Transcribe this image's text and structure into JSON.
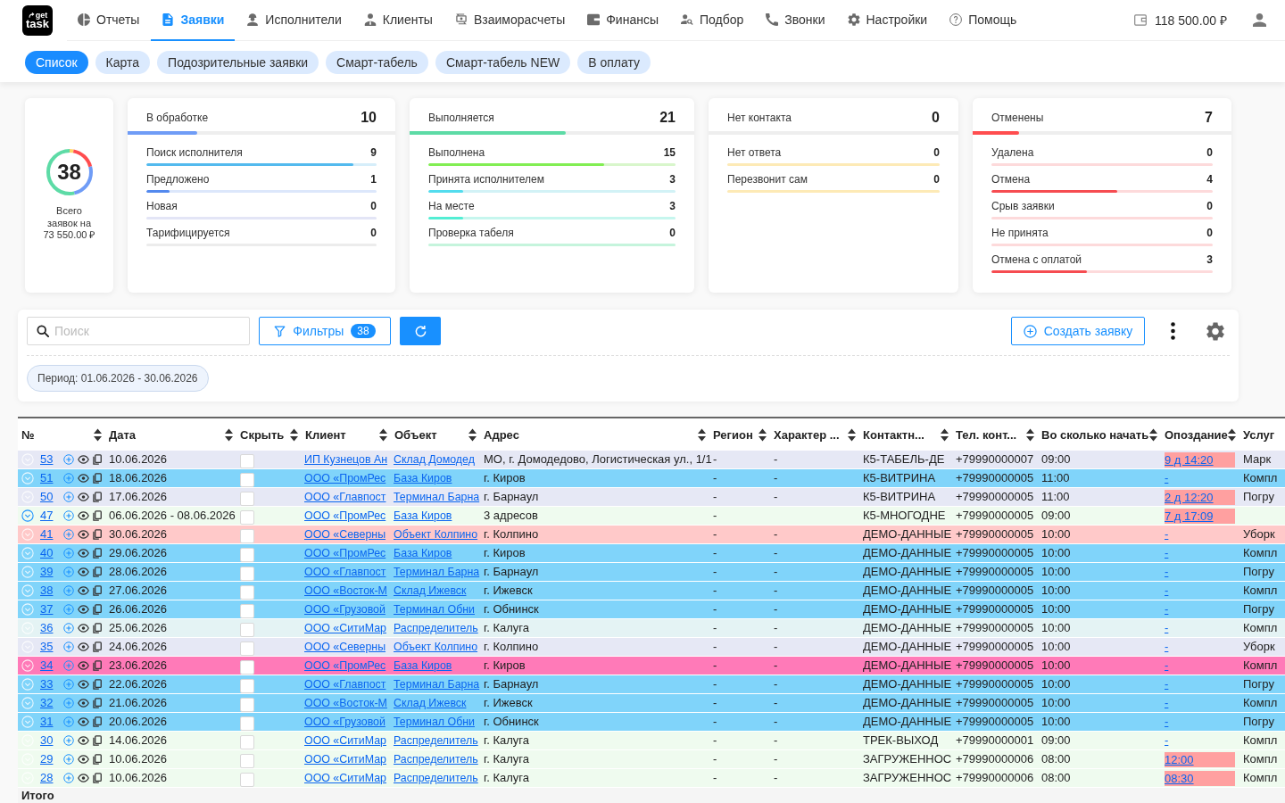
{
  "logo": {
    "line_1": "get",
    "line_2": "task"
  },
  "nav": [
    {
      "label": "Отчеты",
      "selected": false
    },
    {
      "label": "Заявки",
      "selected": true
    },
    {
      "label": "Исполнители",
      "selected": false
    },
    {
      "label": "Клиенты",
      "selected": false
    },
    {
      "label": "Взаиморасчеты",
      "selected": false
    },
    {
      "label": "Финансы",
      "selected": false
    },
    {
      "label": "Подбор",
      "selected": false
    },
    {
      "label": "Звонки",
      "selected": false
    },
    {
      "label": "Настройки",
      "selected": false
    },
    {
      "label": "Помощь",
      "selected": false
    }
  ],
  "balance": "118 500.00 ₽",
  "subtabs": [
    {
      "label": "Список",
      "selected": true
    },
    {
      "label": "Карта",
      "selected": false
    },
    {
      "label": "Подозрительные заявки",
      "selected": false
    },
    {
      "label": "Смарт-табель",
      "selected": false
    },
    {
      "label": "Смарт-табель NEW",
      "selected": false
    },
    {
      "label": "В оплату",
      "selected": false
    }
  ],
  "summary": {
    "total": "38",
    "caption": "Всего заявок на 73 550.00 ₽"
  },
  "groups": [
    {
      "title": "В обработке",
      "count": "10",
      "level": 0.26,
      "color": "#6f9cf6",
      "items": [
        {
          "label": "Поиск исполнителя",
          "count": "9",
          "level": 0.9,
          "color": "#d6eefa"
        },
        {
          "label": "Предложено",
          "count": "1",
          "level": 0.1,
          "color": "#dce7fb"
        },
        {
          "label": "Новая",
          "count": "0",
          "level": 0,
          "color": "#e3e5f6"
        },
        {
          "label": "Тарифицируется",
          "count": "0",
          "level": 0,
          "color": "#ececec"
        }
      ]
    },
    {
      "title": "Выполняется",
      "count": "21",
      "level": 0.55,
      "color": "#5ddba6",
      "items": [
        {
          "label": "Выполнена",
          "count": "15",
          "level": 0.71,
          "color": "#d8f6cb"
        },
        {
          "label": "Принята исполнителем",
          "count": "3",
          "level": 0.14,
          "color": "#d2f2f6"
        },
        {
          "label": "На месте",
          "count": "3",
          "level": 0.14,
          "color": "#c6f6ee"
        },
        {
          "label": "Проверка табеля",
          "count": "0",
          "level": 0,
          "color": "#c5f4dc"
        }
      ]
    },
    {
      "title": "Нет контакта",
      "count": "0",
      "level": 0,
      "color": "#ffd666",
      "items": [
        {
          "label": "Нет ответа",
          "count": "0",
          "level": 0,
          "color": "#fdeab6"
        },
        {
          "label": "Перезвонит сам",
          "count": "0",
          "level": 0,
          "color": "#fdeab6"
        }
      ]
    },
    {
      "title": "Отменены",
      "count": "7",
      "level": 0.18,
      "color": "#ff4d4f",
      "items": [
        {
          "label": "Удалена",
          "count": "0",
          "level": 0,
          "color": "#fddadb"
        },
        {
          "label": "Отмена",
          "count": "4",
          "level": 0.57,
          "color": "#fddadb"
        },
        {
          "label": "Срыв заявки",
          "count": "0",
          "level": 0,
          "color": "#fddadb"
        },
        {
          "label": "Не принята",
          "count": "0",
          "level": 0,
          "color": "#fddadb"
        },
        {
          "label": "Отмена с оплатой",
          "count": "3",
          "level": 0.43,
          "color": "#fddadb"
        }
      ]
    }
  ],
  "toolbar": {
    "search": {
      "placeholder": "Поиск"
    },
    "filters": {
      "label": "Фильтры",
      "count": "38"
    },
    "create": {
      "label": "Создать заявку"
    },
    "period": "Период: 01.06.2026 - 30.06.2026"
  },
  "table": {
    "columns": [
      {
        "label": "№",
        "sortable": true
      },
      {
        "label": "Дата",
        "sortable": true
      },
      {
        "label": "Скрыть",
        "sortable": true
      },
      {
        "label": "Клиент",
        "sortable": true
      },
      {
        "label": "Объект",
        "sortable": true
      },
      {
        "label": "Адрес",
        "sortable": true
      },
      {
        "label": "Регион",
        "sortable": true
      },
      {
        "label": "Характер ...",
        "sortable": true
      },
      {
        "label": "Контактн...",
        "sortable": true
      },
      {
        "label": "Тел. конт...",
        "sortable": true
      },
      {
        "label": "Во сколько начать",
        "sortable": true
      },
      {
        "label": "Опоздание",
        "sortable": true
      },
      {
        "label": "Услуг",
        "sortable": false
      }
    ],
    "rows": [
      {
        "number": "53",
        "expandable": false,
        "date": "10.06.2026",
        "checked": false,
        "client": "ИП Кузнецов Ан",
        "object": "Склад Домодед",
        "address": "МО, г. Домодедово, Логистическая ул., 1/1",
        "region": "-",
        "character": "-",
        "contact": "К5-ТАБЕЛЬ-ДЕ",
        "phone": "+79990000007",
        "start": "09:00",
        "delay": "9 д 14:20",
        "late": true,
        "service": "Марк",
        "color": "#e6e8f5"
      },
      {
        "number": "51",
        "expandable": false,
        "date": "18.06.2026",
        "checked": false,
        "client": "ООО «ПромРес",
        "object": "База Киров",
        "address": "г. Киров",
        "region": "-",
        "character": "-",
        "contact": "К5-ВИТРИНА",
        "phone": "+79990000005",
        "start": "11:00",
        "delay": "-",
        "late": false,
        "service": "Компл",
        "color": "#80d4fa"
      },
      {
        "number": "50",
        "expandable": false,
        "date": "17.06.2026",
        "checked": false,
        "client": "ООО «Главпост",
        "object": "Терминал Барна",
        "address": "г. Барнаул",
        "region": "-",
        "character": "-",
        "contact": "К5-ВИТРИНА",
        "phone": "+79990000005",
        "start": "11:00",
        "delay": "2 д 12:20",
        "late": true,
        "service": "Погру",
        "color": "#e6e8f5"
      },
      {
        "number": "47",
        "expandable": true,
        "date": "06.06.2026 - 08.06.2026",
        "checked": false,
        "client": "ООО «ПромРес",
        "object": "База Киров",
        "address": "3 адресов",
        "region": "-",
        "contact": "К5-МНОГОДНЕ",
        "phone": "+79990000005",
        "start": "09:00",
        "delay": "7 д 17:09",
        "late": true,
        "color": "#effbef"
      },
      {
        "number": "41",
        "expandable": false,
        "date": "30.06.2026",
        "checked": false,
        "client": "ООО «Северны",
        "object": "Объект Колпино",
        "address": "г. Колпино",
        "region": "-",
        "character": "-",
        "contact": "ДЕМО-ДАННЫЕ",
        "phone": "+79990000005",
        "start": "10:00",
        "delay": "-",
        "late": false,
        "service": "Уборк",
        "color": "#ffc9c9"
      },
      {
        "number": "40",
        "expandable": false,
        "date": "29.06.2026",
        "checked": false,
        "client": "ООО «ПромРес",
        "object": "База Киров",
        "address": "г. Киров",
        "region": "-",
        "character": "-",
        "contact": "ДЕМО-ДАННЫЕ",
        "phone": "+79990000005",
        "start": "10:00",
        "delay": "-",
        "late": false,
        "service": "Компл",
        "color": "#80d4fa"
      },
      {
        "number": "39",
        "expandable": false,
        "date": "28.06.2026",
        "checked": false,
        "client": "ООО «Главпост",
        "object": "Терминал Барна",
        "address": "г. Барнаул",
        "region": "-",
        "character": "-",
        "contact": "ДЕМО-ДАННЫЕ",
        "phone": "+79990000005",
        "start": "10:00",
        "delay": "-",
        "late": false,
        "service": "Погру",
        "color": "#80d4fa"
      },
      {
        "number": "38",
        "expandable": false,
        "date": "27.06.2026",
        "checked": false,
        "client": "ООО «Восток-М",
        "object": "Склад Ижевск",
        "address": "г. Ижевск",
        "region": "-",
        "character": "-",
        "contact": "ДЕМО-ДАННЫЕ",
        "phone": "+79990000005",
        "start": "10:00",
        "delay": "-",
        "late": false,
        "service": "Компл",
        "color": "#80d4fa"
      },
      {
        "number": "37",
        "expandable": false,
        "date": "26.06.2026",
        "checked": false,
        "client": "ООО «Грузовой",
        "object": "Терминал Обни",
        "address": "г. Обнинск",
        "region": "-",
        "character": "-",
        "contact": "ДЕМО-ДАННЫЕ",
        "phone": "+79990000005",
        "start": "10:00",
        "delay": "-",
        "late": false,
        "service": "Погру",
        "color": "#80d4fa"
      },
      {
        "number": "36",
        "expandable": false,
        "date": "25.06.2026",
        "checked": false,
        "client": "ООО «СитиМар",
        "object": "Распределитель",
        "address": "г. Калуга",
        "region": "-",
        "character": "-",
        "contact": "ДЕМО-ДАННЫЕ",
        "phone": "+79990000005",
        "start": "10:00",
        "delay": "-",
        "late": false,
        "service": "Компл",
        "color": "#e4f3f4"
      },
      {
        "number": "35",
        "expandable": false,
        "date": "24.06.2026",
        "checked": false,
        "client": "ООО «Северны",
        "object": "Объект Колпино",
        "address": "г. Колпино",
        "region": "-",
        "character": "-",
        "contact": "ДЕМО-ДАННЫЕ",
        "phone": "+79990000005",
        "start": "10:00",
        "delay": "-",
        "late": false,
        "service": "Уборк",
        "color": "#e6e8f5"
      },
      {
        "number": "34",
        "expandable": false,
        "date": "23.06.2026",
        "checked": false,
        "client": "ООО «ПромРес",
        "object": "База Киров",
        "address": "г. Киров",
        "region": "-",
        "character": "-",
        "contact": "ДЕМО-ДАННЫЕ",
        "phone": "+79990000005",
        "start": "10:00",
        "delay": "-",
        "late": false,
        "service": "Компл",
        "color": "#ff7ab8"
      },
      {
        "number": "33",
        "expandable": false,
        "date": "22.06.2026",
        "checked": false,
        "client": "ООО «Главпост",
        "object": "Терминал Барна",
        "address": "г. Барнаул",
        "region": "-",
        "character": "-",
        "contact": "ДЕМО-ДАННЫЕ",
        "phone": "+79990000005",
        "start": "10:00",
        "delay": "-",
        "late": false,
        "service": "Погру",
        "color": "#80d4fa"
      },
      {
        "number": "32",
        "expandable": false,
        "date": "21.06.2026",
        "checked": false,
        "client": "ООО «Восток-М",
        "object": "Склад Ижевск",
        "address": "г. Ижевск",
        "region": "-",
        "character": "-",
        "contact": "ДЕМО-ДАННЫЕ",
        "phone": "+79990000005",
        "start": "10:00",
        "delay": "-",
        "late": false,
        "service": "Компл",
        "color": "#80d4fa"
      },
      {
        "number": "31",
        "expandable": false,
        "date": "20.06.2026",
        "checked": false,
        "client": "ООО «Грузовой",
        "object": "Терминал Обни",
        "address": "г. Обнинск",
        "region": "-",
        "character": "-",
        "contact": "ДЕМО-ДАННЫЕ",
        "phone": "+79990000005",
        "start": "10:00",
        "delay": "-",
        "late": false,
        "service": "Погру",
        "color": "#80d4fa"
      },
      {
        "number": "30",
        "expandable": false,
        "date": "14.06.2026",
        "checked": false,
        "client": "ООО «СитиМар",
        "object": "Распределитель",
        "address": "г. Калуга",
        "region": "-",
        "character": "-",
        "contact": "ТРЕК-ВЫХОД",
        "phone": "+79990000001",
        "start": "09:00",
        "delay": "-",
        "late": false,
        "service": "Компл",
        "color": "#effbef"
      },
      {
        "number": "29",
        "expandable": false,
        "date": "10.06.2026",
        "checked": false,
        "client": "ООО «СитиМар",
        "object": "Распределитель",
        "address": "г. Калуга",
        "region": "-",
        "character": "-",
        "contact": "ЗАГРУЖЕННОС",
        "phone": "+79990000006",
        "start": "08:00",
        "delay": "12:00",
        "late": true,
        "service": "Компл",
        "color": "#effbef"
      },
      {
        "number": "28",
        "expandable": false,
        "date": "10.06.2026",
        "checked": false,
        "client": "ООО «СитиМар",
        "object": "Распределитель",
        "address": "г. Калуга",
        "region": "-",
        "character": "-",
        "contact": "ЗАГРУЖЕННОС",
        "phone": "+79990000006",
        "start": "08:00",
        "delay": "08:30",
        "late": true,
        "service": "Компл",
        "color": "#effbef"
      }
    ],
    "footer": "Итого"
  }
}
